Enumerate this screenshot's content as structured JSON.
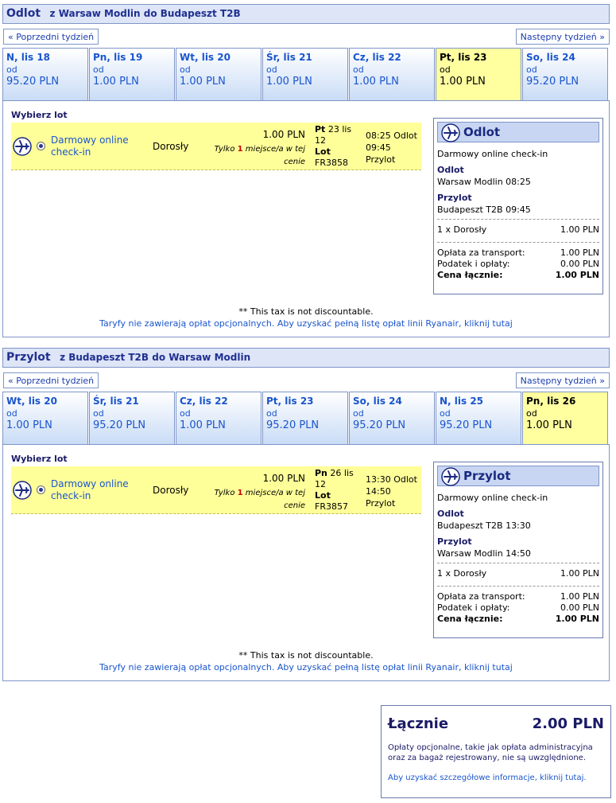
{
  "outbound": {
    "header": {
      "title": "Odlot",
      "route": "z Warsaw Modlin do Budapeszt T2B"
    },
    "prev_week": "« Poprzedni tydzień",
    "next_week": "Następny tydzień »",
    "days": [
      {
        "label": "N, lis 18",
        "od": "od",
        "price": "95.20 PLN",
        "selected": false
      },
      {
        "label": "Pn, lis 19",
        "od": "od",
        "price": "1.00 PLN",
        "selected": false
      },
      {
        "label": "Wt, lis 20",
        "od": "od",
        "price": "1.00 PLN",
        "selected": false
      },
      {
        "label": "Śr, lis 21",
        "od": "od",
        "price": "1.00 PLN",
        "selected": false
      },
      {
        "label": "Cz, lis 22",
        "od": "od",
        "price": "1.00 PLN",
        "selected": false
      },
      {
        "label": "Pt, lis 23",
        "od": "od",
        "price": "1.00 PLN",
        "selected": true
      },
      {
        "label": "So, lis 24",
        "od": "od",
        "price": "95.20 PLN",
        "selected": false
      }
    ],
    "choose_title": "Wybierz lot",
    "flight": {
      "checkin": "Darmowy online check-in",
      "pax": "Dorosły",
      "price": "1.00 PLN",
      "seats_pre": "Tylko",
      "seats_num": "1",
      "seats_post": "miejsce/a w tej cenie",
      "date_day": "Pt",
      "date_rest": "23 lis 12",
      "lot_label": "Lot",
      "flight_no": "FR3858",
      "dep_time": "08:25 Odlot",
      "arr_time": "09:45",
      "arr_label": "Przylot"
    },
    "summary": {
      "title": "Odlot",
      "checkin": "Darmowy online check-in",
      "dep_label": "Odlot",
      "dep_value": "Warsaw Modlin 08:25",
      "arr_label": "Przylot",
      "arr_value": "Budapeszt T2B 09:45",
      "pax_label": "1 x Dorosły",
      "pax_value": "1.00 PLN",
      "transport_label": "Opłata za transport:",
      "transport_value": "1.00 PLN",
      "tax_label": "Podatek i opłaty:",
      "tax_value": "0.00 PLN",
      "total_label": "Cena łącznie:",
      "total_value": "1.00 PLN"
    },
    "note_tax": "** This tax is not discountable.",
    "note_link": "Taryfy nie zawierają opłat opcjonalnych. Aby uzyskać pełną listę opłat linii Ryanair, kliknij tutaj"
  },
  "inbound": {
    "header": {
      "title": "Przylot",
      "route": "z Budapeszt T2B do Warsaw Modlin"
    },
    "prev_week": "« Poprzedni tydzień",
    "next_week": "Następny tydzień »",
    "days": [
      {
        "label": "Wt, lis 20",
        "od": "od",
        "price": "1.00 PLN",
        "selected": false
      },
      {
        "label": "Śr, lis 21",
        "od": "od",
        "price": "95.20 PLN",
        "selected": false
      },
      {
        "label": "Cz, lis 22",
        "od": "od",
        "price": "1.00 PLN",
        "selected": false
      },
      {
        "label": "Pt, lis 23",
        "od": "od",
        "price": "95.20 PLN",
        "selected": false
      },
      {
        "label": "So, lis 24",
        "od": "od",
        "price": "95.20 PLN",
        "selected": false
      },
      {
        "label": "N, lis 25",
        "od": "od",
        "price": "95.20 PLN",
        "selected": false
      },
      {
        "label": "Pn, lis 26",
        "od": "od",
        "price": "1.00 PLN",
        "selected": true
      }
    ],
    "choose_title": "Wybierz lot",
    "flight": {
      "checkin": "Darmowy online check-in",
      "pax": "Dorosły",
      "price": "1.00 PLN",
      "seats_pre": "Tylko",
      "seats_num": "1",
      "seats_post": "miejsce/a w tej cenie",
      "date_day": "Pn",
      "date_rest": "26 lis 12",
      "lot_label": "Lot",
      "flight_no": "FR3857",
      "dep_time": "13:30 Odlot",
      "arr_time": "14:50",
      "arr_label": "Przylot"
    },
    "summary": {
      "title": "Przylot",
      "checkin": "Darmowy online check-in",
      "dep_label": "Odlot",
      "dep_value": "Budapeszt T2B 13:30",
      "arr_label": "Przylot",
      "arr_value": "Warsaw Modlin 14:50",
      "pax_label": "1 x Dorosły",
      "pax_value": "1.00 PLN",
      "transport_label": "Opłata za transport:",
      "transport_value": "1.00 PLN",
      "tax_label": "Podatek i opłaty:",
      "tax_value": "0.00 PLN",
      "total_label": "Cena łącznie:",
      "total_value": "1.00 PLN"
    },
    "note_tax": "** This tax is not discountable.",
    "note_link": "Taryfy nie zawierają opłat opcjonalnych. Aby uzyskać pełną listę opłat linii Ryanair, kliknij tutaj"
  },
  "total": {
    "label": "Łącznie",
    "value": "2.00 PLN",
    "note": "Opłaty opcjonalne, takie jak opłata administracyjna oraz za bagaż rejestrowany, nie są uwzględnione.",
    "link": "Aby uzyskać szczegółowe informacje, kliknij tutaj."
  },
  "colors": {
    "accent": "#1a55cc",
    "header_bg": "#dde5f7",
    "selected_day": "#ffffa0",
    "flight_row": "#ffff99",
    "seats_red": "#cc0000"
  },
  "icons": {
    "plane": "airplane-icon",
    "radio": "radio-selected"
  }
}
